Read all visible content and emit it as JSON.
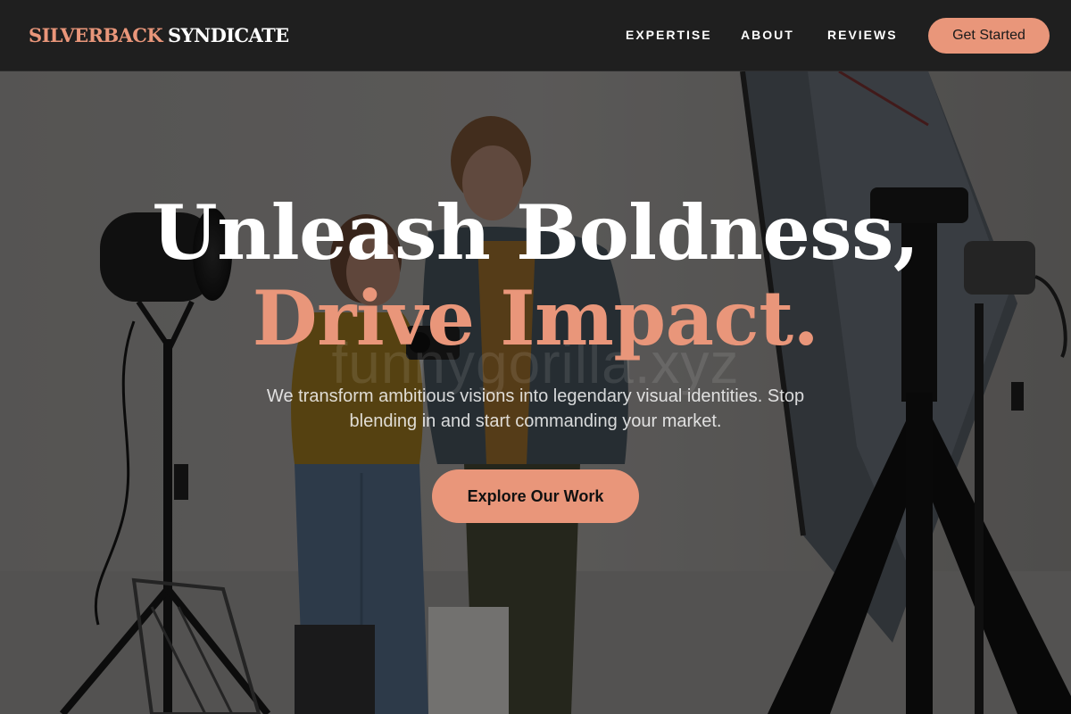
{
  "brand": {
    "name_accent": "SILVERBACK",
    "name_main": "SYNDICATE"
  },
  "nav": {
    "links": [
      {
        "label": "EXPERTISE"
      },
      {
        "label": "ABOUT"
      },
      {
        "label": "REVIEWS"
      }
    ],
    "cta_label": "Get Started"
  },
  "hero": {
    "headline_line1": "Unleash Boldness,",
    "headline_line2": "Drive Impact.",
    "subtext": "We transform ambitious visions into legendary visual identities. Stop blending in and start commanding your market.",
    "button_label": "Explore Our Work",
    "watermark": "funnygorilla.xyz"
  },
  "colors": {
    "accent": "#e9967a",
    "navbar_bg": "#1f1f1f",
    "text_light": "#ffffff"
  }
}
